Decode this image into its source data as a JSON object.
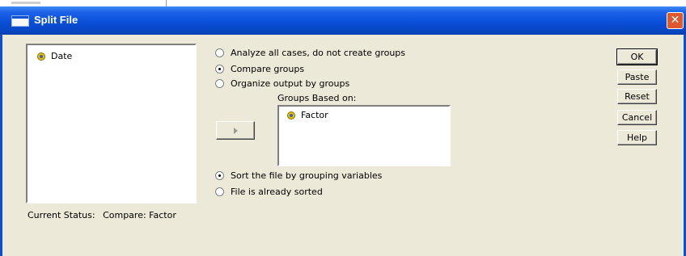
{
  "dialog": {
    "title": "Split File",
    "close_icon": "close-icon"
  },
  "variables_list": {
    "items": [
      {
        "label": "Date",
        "icon": "scale-variable-icon"
      }
    ]
  },
  "split_options": [
    {
      "label": "Analyze all cases, do not create groups",
      "checked": false
    },
    {
      "label": "Compare groups",
      "checked": true
    },
    {
      "label": "Organize output by groups",
      "checked": false
    }
  ],
  "groups": {
    "label": "Groups Based on:",
    "items": [
      {
        "label": "Factor",
        "icon": "scale-variable-icon"
      }
    ]
  },
  "sort_options": [
    {
      "label": "Sort the file by grouping variables",
      "checked": true
    },
    {
      "label": "File is already sorted",
      "checked": false
    }
  ],
  "status": {
    "label": "Current Status:",
    "value": "Compare: Factor"
  },
  "buttons": {
    "ok": "OK",
    "paste": "Paste",
    "reset": "Reset",
    "cancel": "Cancel",
    "help": "Help"
  }
}
